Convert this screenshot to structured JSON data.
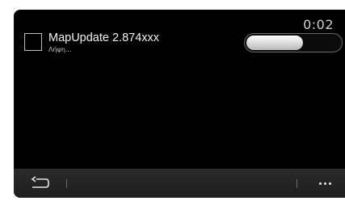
{
  "status_bar": {
    "clock": "0:02"
  },
  "update_item": {
    "title": "MapUpdate 2.874xxx",
    "status": "Λήψη...",
    "checked": false,
    "progress_fraction": 0.6
  },
  "bottom_bar": {
    "back_icon": "back-arrow-icon",
    "menu_icon": "more-dots-icon"
  },
  "colors": {
    "screen_background": "#000000",
    "bar_background": "#242424",
    "text_primary": "#f2f2f2",
    "text_secondary": "#c8c8c8"
  }
}
